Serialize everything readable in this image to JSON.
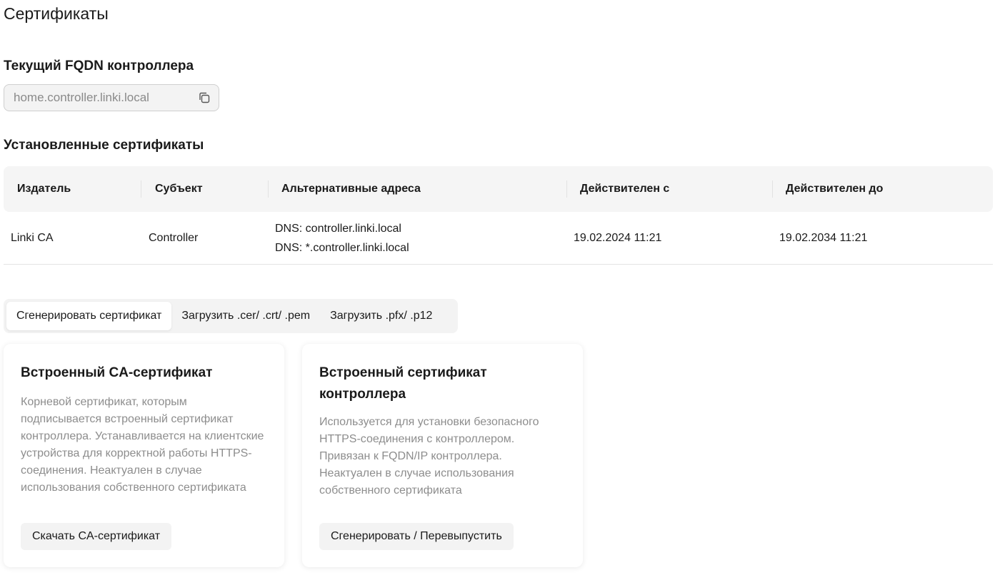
{
  "page": {
    "title": "Сертификаты"
  },
  "fqdn": {
    "label": "Текущий FQDN контроллера",
    "value": "home.controller.linki.local",
    "copy_icon": "copy-icon"
  },
  "installed": {
    "title": "Установленные сертификаты",
    "columns": [
      "Издатель",
      "Субъект",
      "Альтернативные адреса",
      "Действителен с",
      "Действителен до"
    ],
    "rows": [
      {
        "issuer": "Linki CA",
        "subject": "Controller",
        "alt_names": [
          "DNS: controller.linki.local",
          "DNS: *.controller.linki.local"
        ],
        "valid_from": "19.02.2024 11:21",
        "valid_to": "19.02.2034 11:21"
      }
    ]
  },
  "tabs": [
    {
      "label": "Сгенерировать сертификат",
      "active": true
    },
    {
      "label": "Загрузить .cer/ .crt/ .pem",
      "active": false
    },
    {
      "label": "Загрузить .pfx/ .p12",
      "active": false
    }
  ],
  "cards": [
    {
      "title": "Встроенный CA-сертификат",
      "description": "Корневой сертификат, которым подписывается встроенный сертификат контроллера. Устанавливается на клиентские устройства для корректной работы HTTPS-соединения. Неактуален в случае использования собственного сертификата",
      "button": "Скачать CA-сертификат"
    },
    {
      "title": "Встроенный сертификат контроллера",
      "description": "Используется для установки безопасного HTTPS-соединения с контроллером. Привязан к FQDN/IP контроллера. Неактуален в случае использования собственного сертификата",
      "button": "Сгенерировать / Перевыпустить"
    }
  ]
}
